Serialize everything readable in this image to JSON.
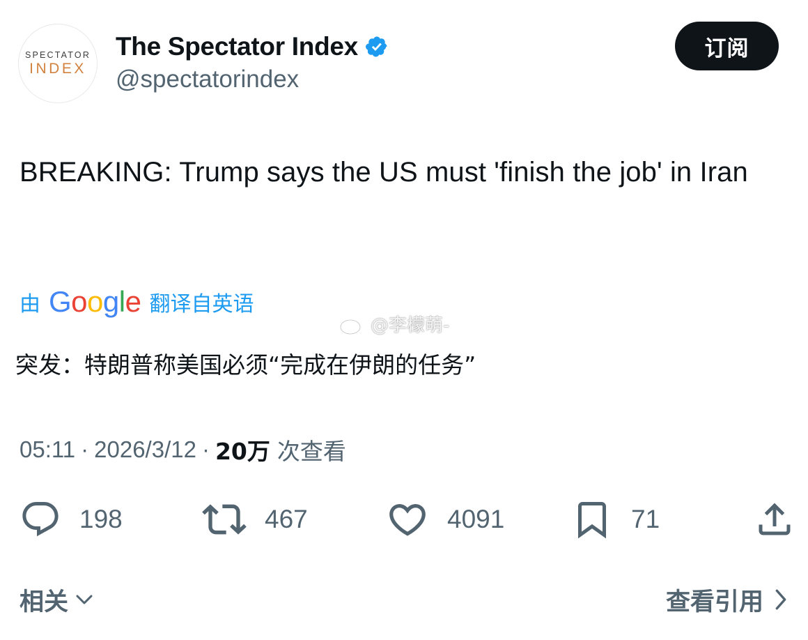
{
  "header": {
    "display_name": "The Spectator Index",
    "handle": "@spectatorindex",
    "avatar_text_top": "SPECTATOR",
    "avatar_text_bottom": "INDEX",
    "subscribe_label": "订阅",
    "verified_icon": "verified-badge-icon",
    "verified_color": "#1d9bf0"
  },
  "tweet": {
    "text": "BREAKING: Trump says the US must 'finish the job' in Iran",
    "translate_by": "由",
    "translate_brand_letters": [
      "G",
      "o",
      "o",
      "g",
      "l",
      "e"
    ],
    "translate_label": "翻译自英语",
    "translated_text": "突发：特朗普称美国必须“完成在伊朗的任务”"
  },
  "watermark": {
    "text": "@李檬萌-",
    "icon": "weibo-icon"
  },
  "meta": {
    "time": "05:11",
    "date": "2026/3/12",
    "separator": "·",
    "view_count": "20万",
    "view_label": "次查看"
  },
  "actions": {
    "replies": {
      "icon": "reply-icon",
      "count": "198"
    },
    "retweets": {
      "icon": "retweet-icon",
      "count": "467"
    },
    "likes": {
      "icon": "heart-icon",
      "count": "4091"
    },
    "bookmarks": {
      "icon": "bookmark-icon",
      "count": "71"
    },
    "share": {
      "icon": "share-icon"
    }
  },
  "footer": {
    "related_label": "相关",
    "quotes_label": "查看引用"
  },
  "colors": {
    "text_primary": "#0f1419",
    "text_secondary": "#536471",
    "accent_blue": "#1d9bf0",
    "avatar_index_orange": "#d1823f"
  }
}
